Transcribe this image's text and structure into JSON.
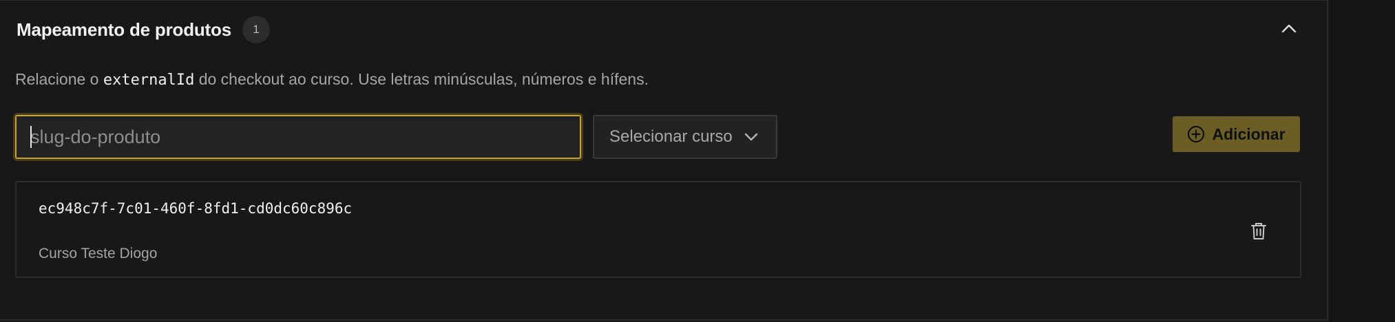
{
  "section": {
    "title": "Mapeamento de produtos",
    "count": "1",
    "collapse_icon": "chevron-up-icon"
  },
  "description": {
    "prefix": "Relacione o ",
    "code": "externalId",
    "suffix": " do checkout ao curso. Use letras minúsculas, números e hífens."
  },
  "form": {
    "slug_placeholder": "slug-do-produto",
    "slug_value": "",
    "course_select_label": "Selecionar curso",
    "add_button_label": "Adicionar"
  },
  "mappings": [
    {
      "external_id": "ec948c7f-7c01-460f-8fd1-cd0dc60c896c",
      "course": "Curso Teste Diogo"
    }
  ],
  "colors": {
    "accent": "#c9a227",
    "button_bg": "#6b5e24",
    "background": "#181818"
  }
}
